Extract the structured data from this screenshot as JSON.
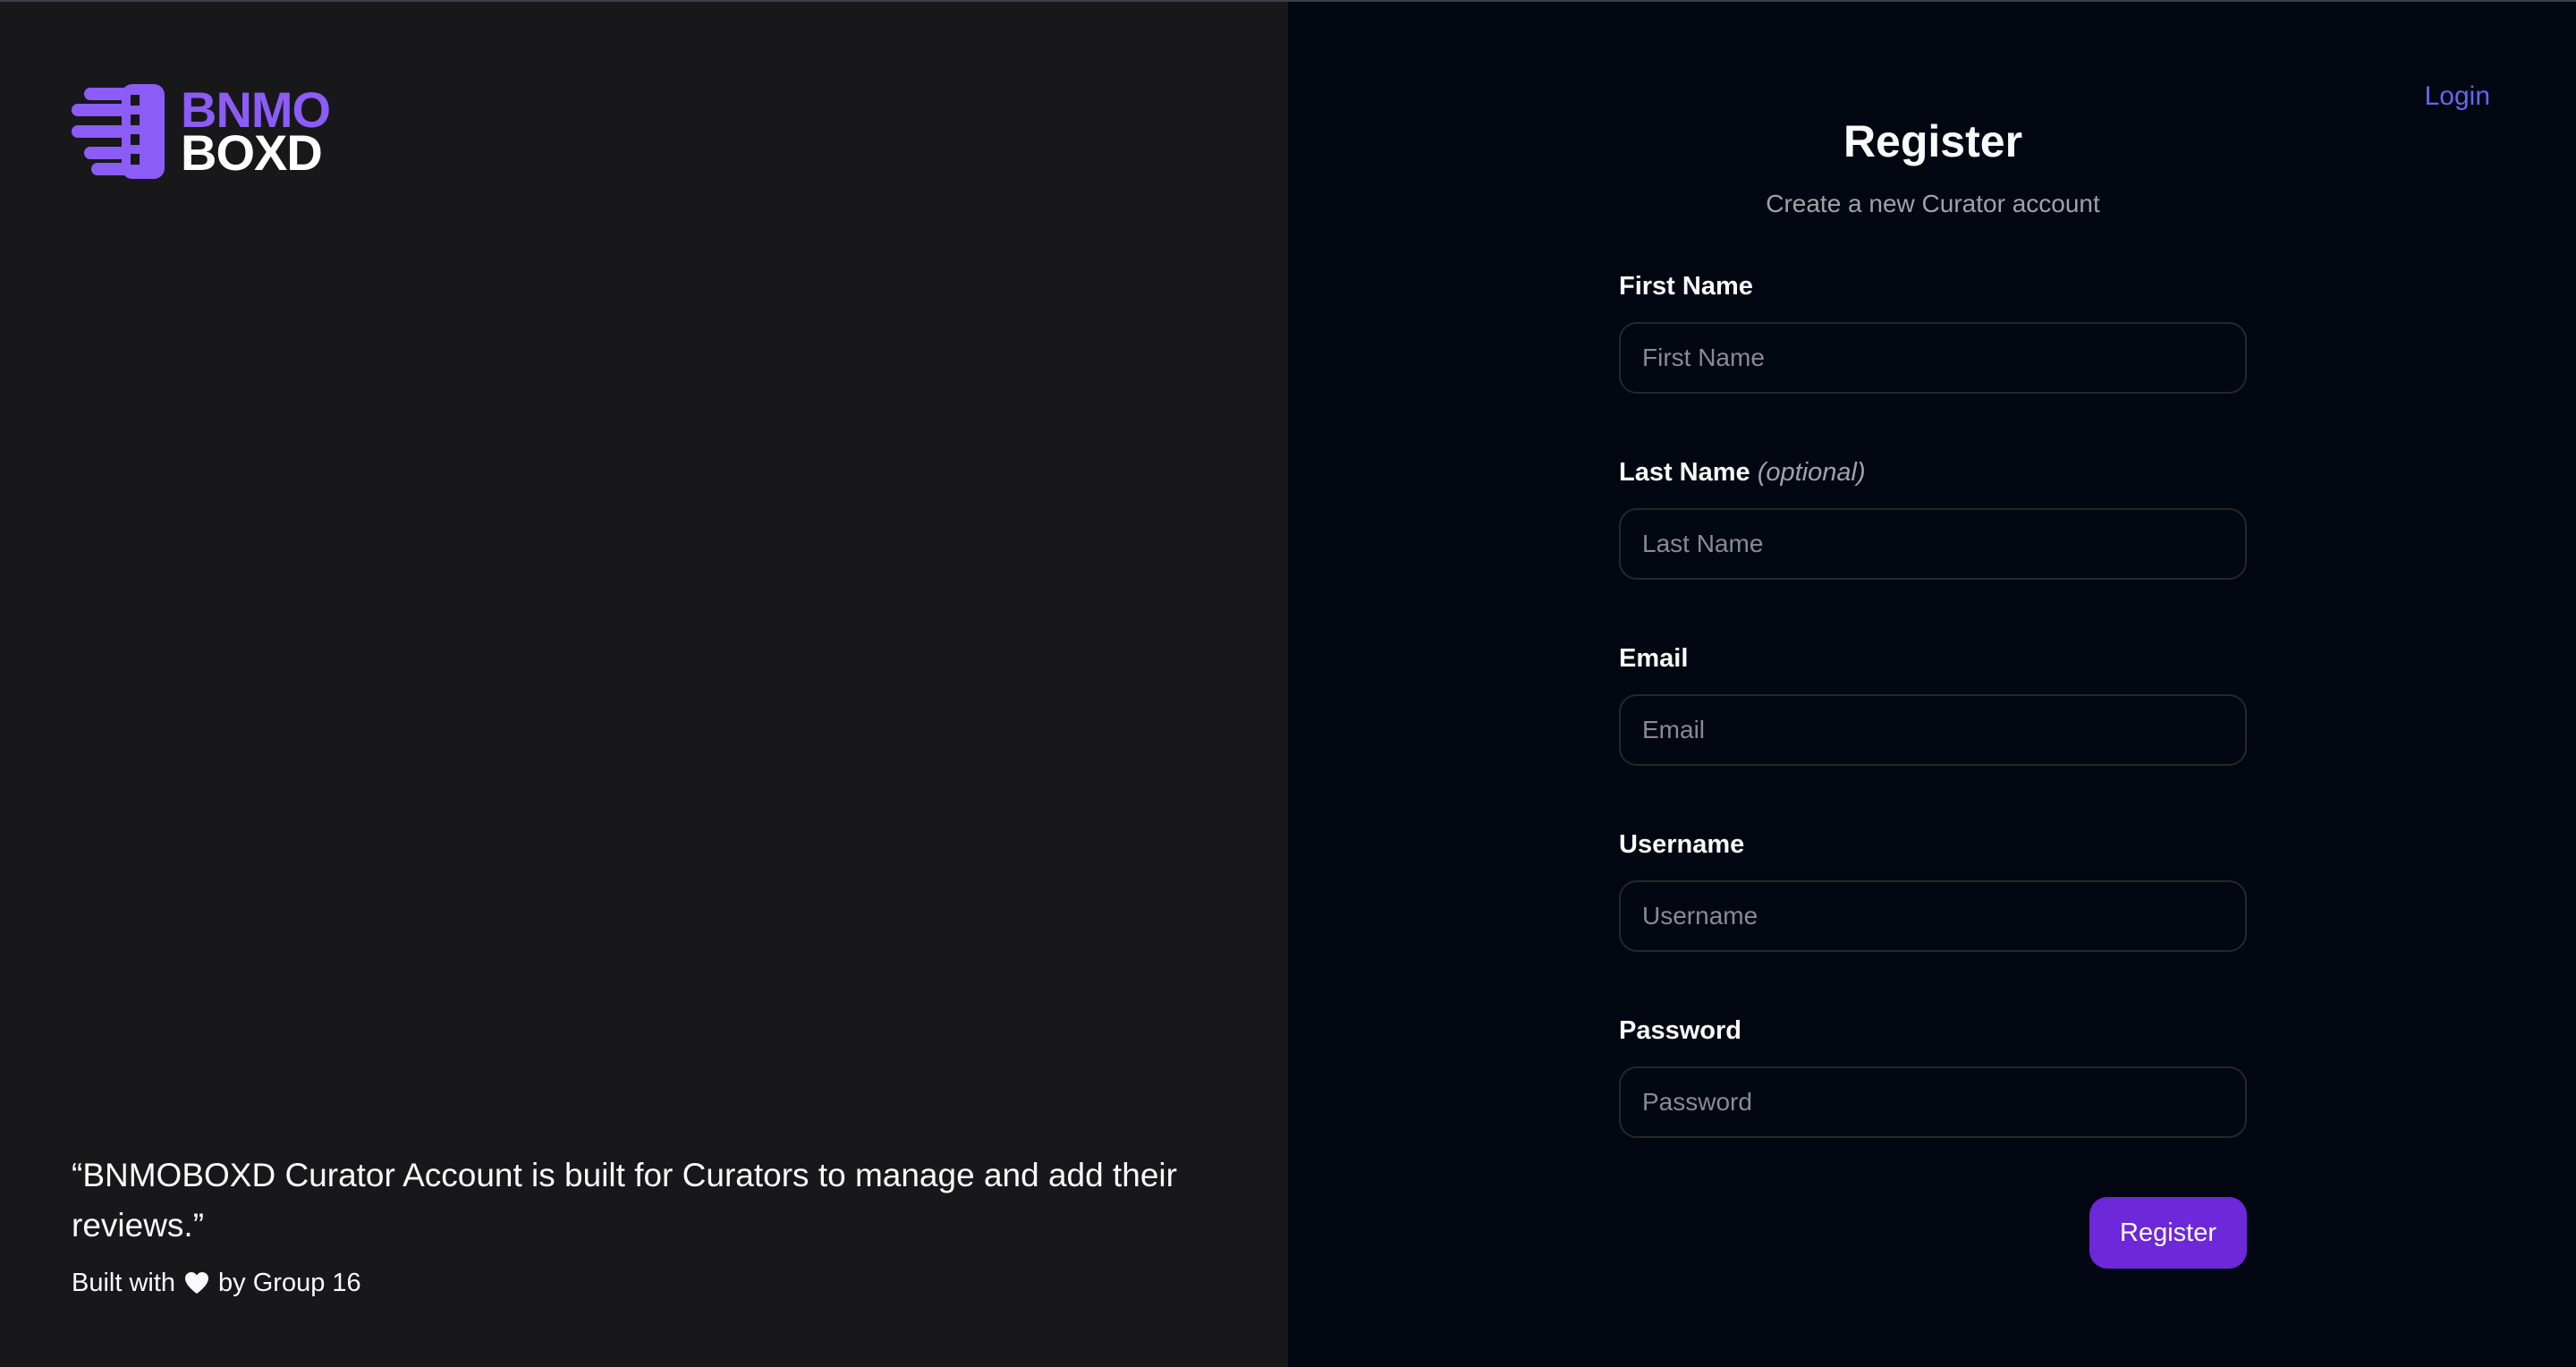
{
  "brand": {
    "line1": "BNMO",
    "line2": "BOXD",
    "accent_color": "#8b5cf6",
    "logo_icon": "film-strip-speed-icon"
  },
  "left": {
    "quote": "“BNMOBOXD Curator Account is built for Curators to manage and add their reviews.”",
    "built_prefix": "Built with",
    "heart_icon": "heart-icon",
    "built_suffix": "by Group 16"
  },
  "nav": {
    "login_label": "Login",
    "link_color": "#6366f1"
  },
  "form": {
    "title": "Register",
    "subtitle": "Create a new Curator account",
    "fields": [
      {
        "label": "First Name",
        "optional": "",
        "placeholder": "First Name",
        "value": ""
      },
      {
        "label": "Last Name",
        "optional": "(optional)",
        "placeholder": "Last Name",
        "value": ""
      },
      {
        "label": "Email",
        "optional": "",
        "placeholder": "Email",
        "value": ""
      },
      {
        "label": "Username",
        "optional": "",
        "placeholder": "Username",
        "value": ""
      },
      {
        "label": "Password",
        "optional": "",
        "placeholder": "Password",
        "value": ""
      }
    ],
    "submit_label": "Register",
    "button_color": "#6d28d9"
  }
}
